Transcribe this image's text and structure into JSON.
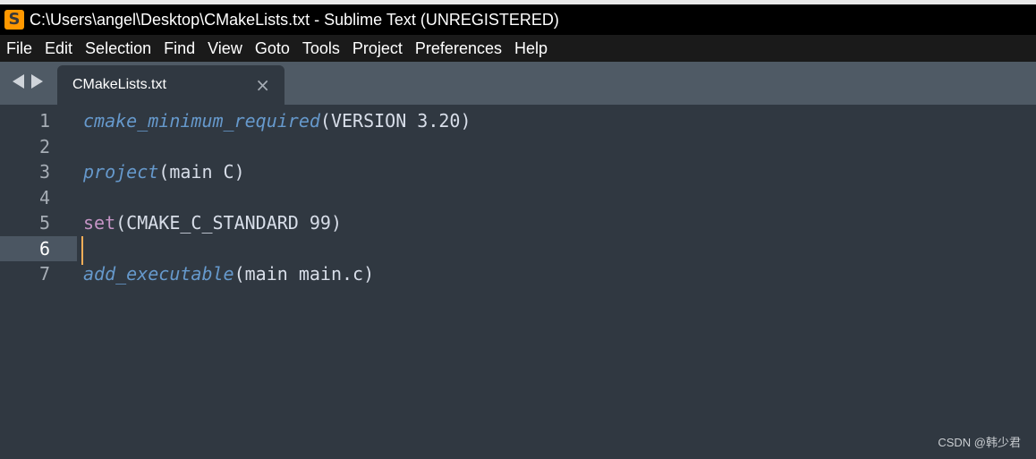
{
  "window": {
    "title": "C:\\Users\\angel\\Desktop\\CMakeLists.txt - Sublime Text (UNREGISTERED)",
    "app_icon_glyph": "S",
    "app_icon_color": "#ff9800"
  },
  "menu": {
    "items": [
      "File",
      "Edit",
      "Selection",
      "Find",
      "View",
      "Goto",
      "Tools",
      "Project",
      "Preferences",
      "Help"
    ]
  },
  "tabs": {
    "nav_icons": [
      "arrow-left-icon",
      "arrow-right-icon"
    ],
    "active": {
      "label": "CMakeLists.txt",
      "close_glyph": "×"
    }
  },
  "editor": {
    "current_line": 6,
    "line_numbers": [
      "1",
      "2",
      "3",
      "4",
      "5",
      "6",
      "7"
    ],
    "lines": [
      {
        "tokens": [
          {
            "text": "cmake_minimum_required",
            "kind": "function"
          },
          {
            "text": "(VERSION 3.20)",
            "kind": "plain"
          }
        ]
      },
      {
        "tokens": []
      },
      {
        "tokens": [
          {
            "text": "project",
            "kind": "function"
          },
          {
            "text": "(main C)",
            "kind": "plain"
          }
        ]
      },
      {
        "tokens": []
      },
      {
        "tokens": [
          {
            "text": "set",
            "kind": "keyword"
          },
          {
            "text": "(CMAKE_C_STANDARD 99)",
            "kind": "plain"
          }
        ]
      },
      {
        "tokens": []
      },
      {
        "tokens": [
          {
            "text": "add_executable",
            "kind": "function"
          },
          {
            "text": "(main main.c)",
            "kind": "plain"
          }
        ]
      }
    ],
    "colors": {
      "background": "#303841",
      "function": "#6699cc",
      "keyword": "#c594c5",
      "plain": "#d8dee9",
      "caret": "#f9ae58"
    }
  },
  "watermark": "CSDN @韩少君"
}
